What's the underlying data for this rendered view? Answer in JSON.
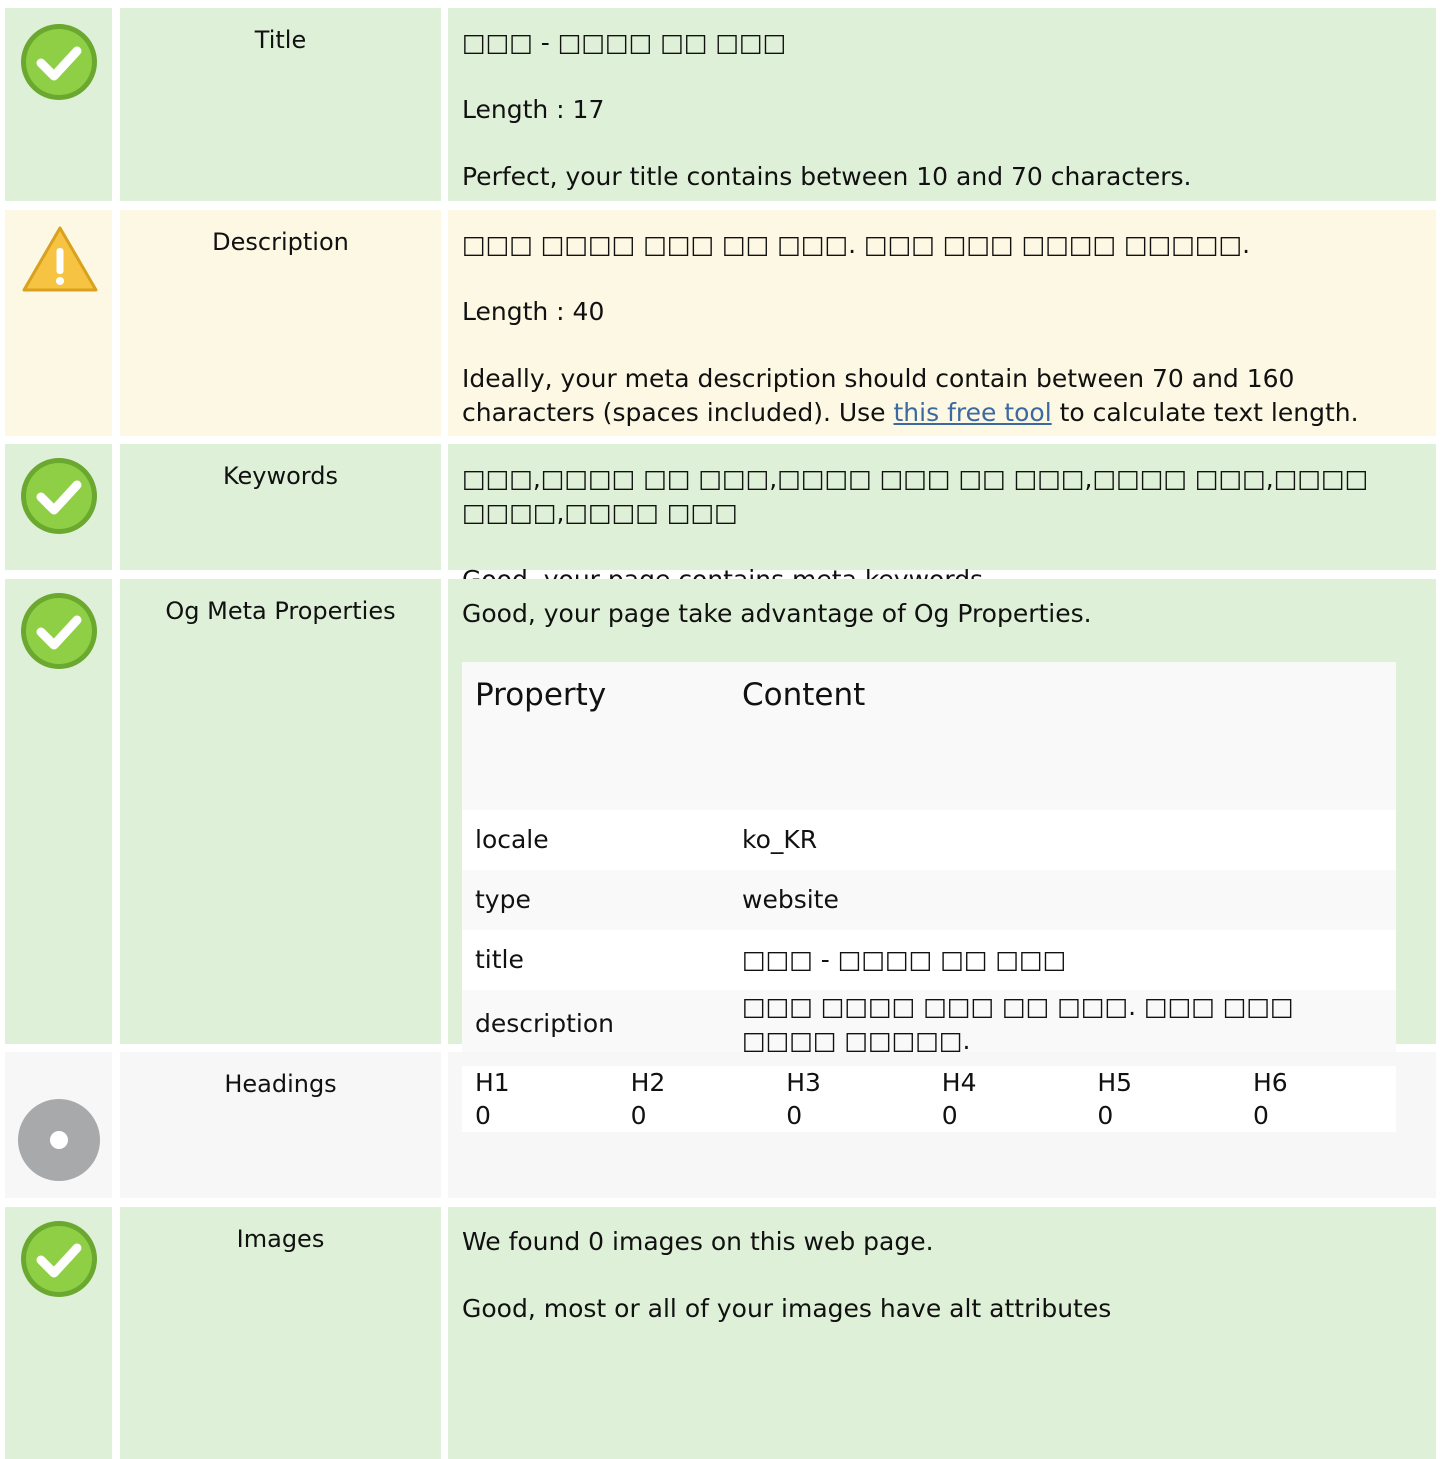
{
  "rows": {
    "title": {
      "label": "Title",
      "status": "success",
      "value": "□□□ - □□□□ □□ □□□",
      "length": "Length : 17",
      "message": "Perfect, your title contains between 10 and 70 characters."
    },
    "description": {
      "label": "Description",
      "status": "warning",
      "value": "□□□ □□□□ □□□ □□ □□□. □□□ □□□ □□□□ □□□□□.",
      "length": "Length : 40",
      "message_pre": "Ideally, your meta description should contain between 70 and 160 characters (spaces included). Use ",
      "link_text": "this free tool",
      "message_post": " to calculate text length."
    },
    "keywords": {
      "label": "Keywords",
      "status": "success",
      "value": "□□□,□□□□ □□ □□□,□□□□ □□□ □□ □□□,□□□□ □□□,□□□□ □□□□,□□□□ □□□",
      "message": "Good, your page contains meta keywords."
    },
    "og": {
      "label": "Og Meta Properties",
      "status": "success",
      "message": "Good, your page take advantage of Og Properties.",
      "table": {
        "header_property": "Property",
        "header_content": "Content",
        "rows": [
          {
            "property": "locale",
            "content": "ko_KR"
          },
          {
            "property": "type",
            "content": "website"
          },
          {
            "property": "title",
            "content": "□□□ - □□□□ □□ □□□"
          },
          {
            "property": "description",
            "content": "□□□ □□□□ □□□ □□ □□□. □□□ □□□ □□□□ □□□□□."
          }
        ]
      }
    },
    "headings": {
      "label": "Headings",
      "status": "neutral",
      "levels": [
        {
          "tag": "H1",
          "count": "0"
        },
        {
          "tag": "H2",
          "count": "0"
        },
        {
          "tag": "H3",
          "count": "0"
        },
        {
          "tag": "H4",
          "count": "0"
        },
        {
          "tag": "H5",
          "count": "0"
        },
        {
          "tag": "H6",
          "count": "0"
        }
      ]
    },
    "images": {
      "label": "Images",
      "status": "success",
      "found": "We found 0 images on this web page.",
      "message": "Good, most or all of your images have alt attributes"
    }
  },
  "colors": {
    "success_bg": "#dff0d8",
    "warning_bg": "#fcf8e3",
    "neutral_bg": "#f7f7f7",
    "check_green": "#7cc242",
    "warning_yellow": "#f6c343",
    "neutral_gray": "#a8a9ab",
    "link": "#3a6aa0"
  },
  "icons": {
    "success": "check-circle-icon",
    "warning": "warning-triangle-icon",
    "neutral": "dot-circle-icon"
  }
}
